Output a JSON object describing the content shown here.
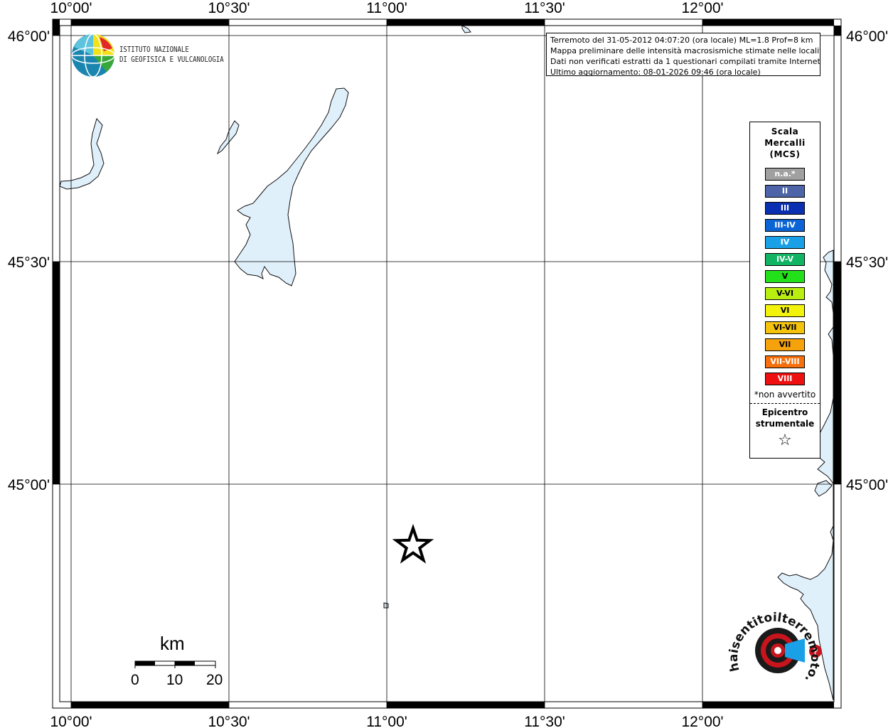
{
  "map": {
    "lon_labels": [
      "10°00'",
      "10°30'",
      "11°00'",
      "11°30'",
      "12°00'"
    ],
    "lat_labels": [
      "46°00'",
      "45°30'",
      "45°00'"
    ]
  },
  "header": {
    "logo_line1": "ISTITUTO NAZIONALE",
    "logo_line2": "DI GEOFISICA E VULCANOLOGIA"
  },
  "info": {
    "line1": "Terremoto del 31-05-2012 04:07:20 (ora locale) ML=1.8 Prof=8 km",
    "line2": "Mappa preliminare delle intensità macrosismiche stimate nelle località",
    "line3": "Dati non verificati estratti da 1 questionari compilati tramite Internet.",
    "line4": "Ultimo aggiornamento: 08-01-2026 09:46 (ora locale)"
  },
  "legend": {
    "title_line1": "Scala",
    "title_line2": "Mercalli",
    "title_line3": "(MCS)",
    "items": [
      {
        "label": "n.a.*",
        "color": "#a0a0a0"
      },
      {
        "label": "II",
        "color": "#4d65a8"
      },
      {
        "label": "III",
        "color": "#0a2fb0"
      },
      {
        "label": "III-IV",
        "color": "#0b64d6"
      },
      {
        "label": "IV",
        "color": "#1aa0e6"
      },
      {
        "label": "IV-V",
        "color": "#10b463"
      },
      {
        "label": "V",
        "color": "#22e01a"
      },
      {
        "label": "V-VI",
        "color": "#b8ee10"
      },
      {
        "label": "VI",
        "color": "#f2f20a"
      },
      {
        "label": "VI-VII",
        "color": "#f5c30c"
      },
      {
        "label": "VII",
        "color": "#f5a20c"
      },
      {
        "label": "VII-VIII",
        "color": "#f5700c"
      },
      {
        "label": "VIII",
        "color": "#ee1010"
      }
    ],
    "note": "*non avvertito",
    "epicenter_line1": "Epicentro",
    "epicenter_line2": "strumentale",
    "epicenter_symbol": "☆"
  },
  "scale": {
    "unit": "km",
    "ticks": [
      "0",
      "10",
      "20"
    ]
  },
  "watermark": {
    "text": "haisentitoilterremoto.it www."
  },
  "colors": {
    "water": "#e0f0fb",
    "coast": "#111111"
  }
}
